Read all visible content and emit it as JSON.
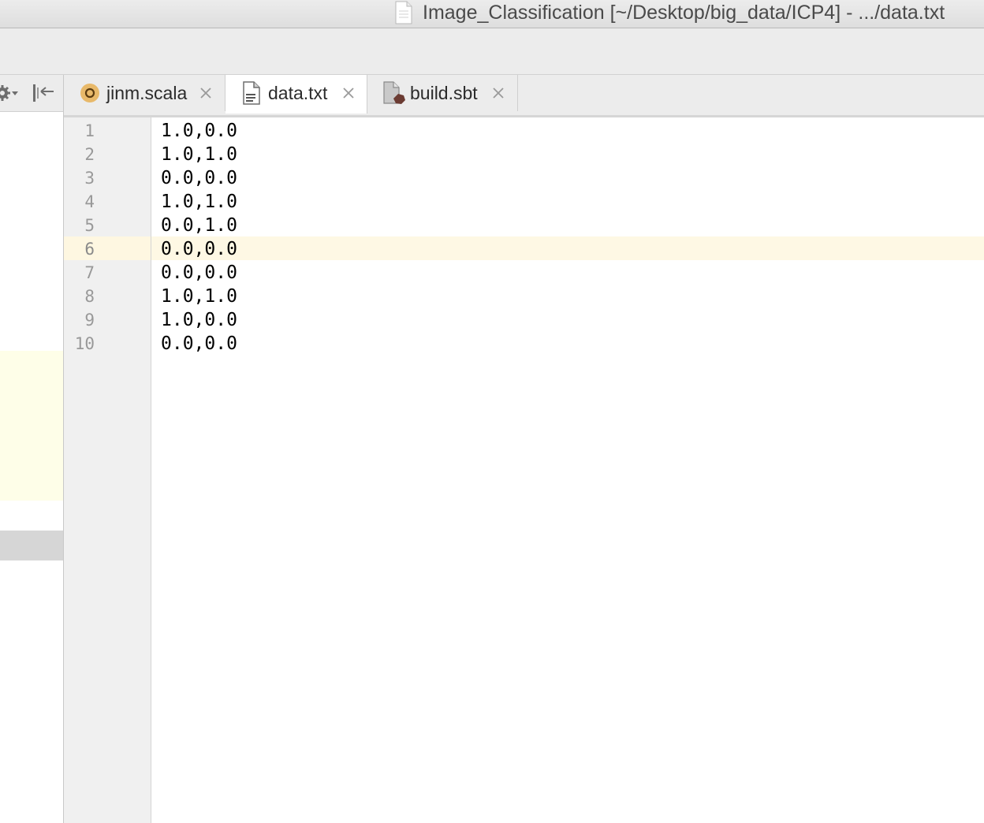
{
  "window": {
    "title": "Image_Classification [~/Desktop/big_data/ICP4] - .../data.txt",
    "title_icon": "document-icon"
  },
  "tabs": [
    {
      "label": "jinm.scala",
      "icon": "scala-object-icon",
      "active": false
    },
    {
      "label": "data.txt",
      "icon": "text-file-icon",
      "active": true
    },
    {
      "label": "build.sbt",
      "icon": "sbt-file-icon",
      "active": false
    }
  ],
  "editor": {
    "current_line": 6,
    "lines": [
      {
        "number": "1",
        "text": "1.0,0.0"
      },
      {
        "number": "2",
        "text": "1.0,1.0"
      },
      {
        "number": "3",
        "text": "0.0,0.0"
      },
      {
        "number": "4",
        "text": "1.0,1.0"
      },
      {
        "number": "5",
        "text": "0.0,1.0"
      },
      {
        "number": "6",
        "text": "0.0,0.0"
      },
      {
        "number": "7",
        "text": "0.0,0.0"
      },
      {
        "number": "8",
        "text": "1.0,1.0"
      },
      {
        "number": "9",
        "text": "1.0,0.0"
      },
      {
        "number": "10",
        "text": "0.0,0.0"
      }
    ]
  },
  "colors": {
    "current_line_bg": "#fef8e4",
    "scala_icon": "#e8b96a",
    "sbt_icon": "#6b3b32"
  }
}
